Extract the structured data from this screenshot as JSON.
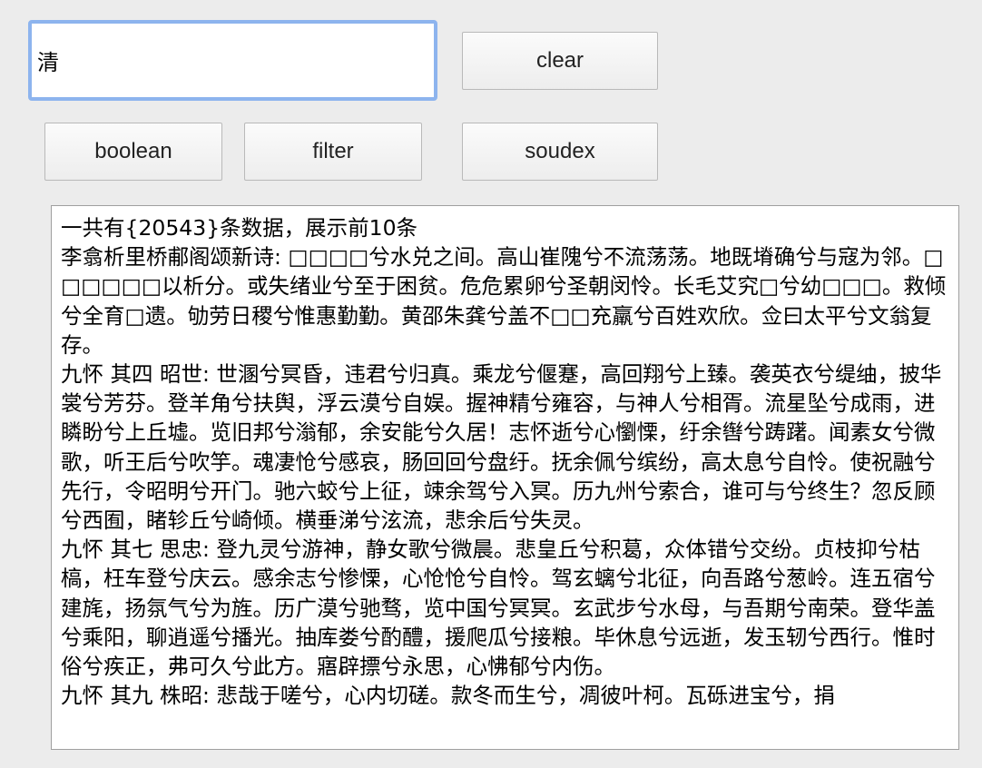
{
  "search": {
    "value": "清"
  },
  "buttons": {
    "clear": "clear",
    "boolean": "boolean",
    "filter": "filter",
    "soudex": "soudex"
  },
  "results": {
    "summary": "一共有{20543}条数据，展示前10条",
    "entries": [
      "李翕析里桥郙阁颂新诗: □□□□兮水兑之间。高山崔隗兮不流荡荡。地既塉确兮与寇为邻。□□□□□□以析分。或失绪业兮至于困贫。危危累卵兮圣朝闵怜。长毛艾究□兮幼□□□。救倾兮全育□遗。劬劳日稷兮惟惠勤勤。黄邵朱龚兮盖不□□充羸兮百姓欢欣。佥曰太平兮文翁复存。",
      "九怀 其四 昭世: 世溷兮冥昏，违君兮归真。乘龙兮偃蹇，高回翔兮上臻。袭英衣兮缇䌷，披华裳兮芳芬。登羊角兮扶舆，浮云漠兮自娱。握神精兮雍容，与神人兮相胥。流星坠兮成雨，进瞵盼兮上丘墟。览旧邦兮滃郁，余安能兮久居！志怀逝兮心懰慄，纡余辔兮踌躇。闻素女兮微歌，听王后兮吹竽。魂凄怆兮感哀，肠回回兮盘纡。抚余佩兮缤纷，高太息兮自怜。使祝融兮先行，令昭明兮开门。驰六蛟兮上征，竦余驾兮入冥。历九州兮索合，谁可与兮终生？忽反顾兮西囿，睹轸丘兮崎倾。横垂涕兮泫流，悲余后兮失灵。",
      "九怀 其七 思忠: 登九灵兮游神，静女歌兮微晨。悲皇丘兮积葛，众体错兮交纷。贞枝抑兮枯槁，枉车登兮庆云。感余志兮惨慄，心怆怆兮自怜。驾玄螭兮北征，向吾路兮葱岭。连五宿兮建旄，扬氛气兮为旌。历广漠兮驰骛，览中国兮冥冥。玄武步兮水母，与吾期兮南荣。登华盖兮乘阳，聊逍遥兮播光。抽库娄兮酌醴，援爬瓜兮接粮。毕休息兮远逝，发玉轫兮西行。惟时俗兮疾正，弗可久兮此方。寤辟摽兮永思，心怫郁兮内伤。",
      "九怀 其九 株昭: 悲哉于嗟兮，心内切磋。款冬而生兮，凋彼叶柯。瓦砾进宝兮，捐"
    ]
  }
}
